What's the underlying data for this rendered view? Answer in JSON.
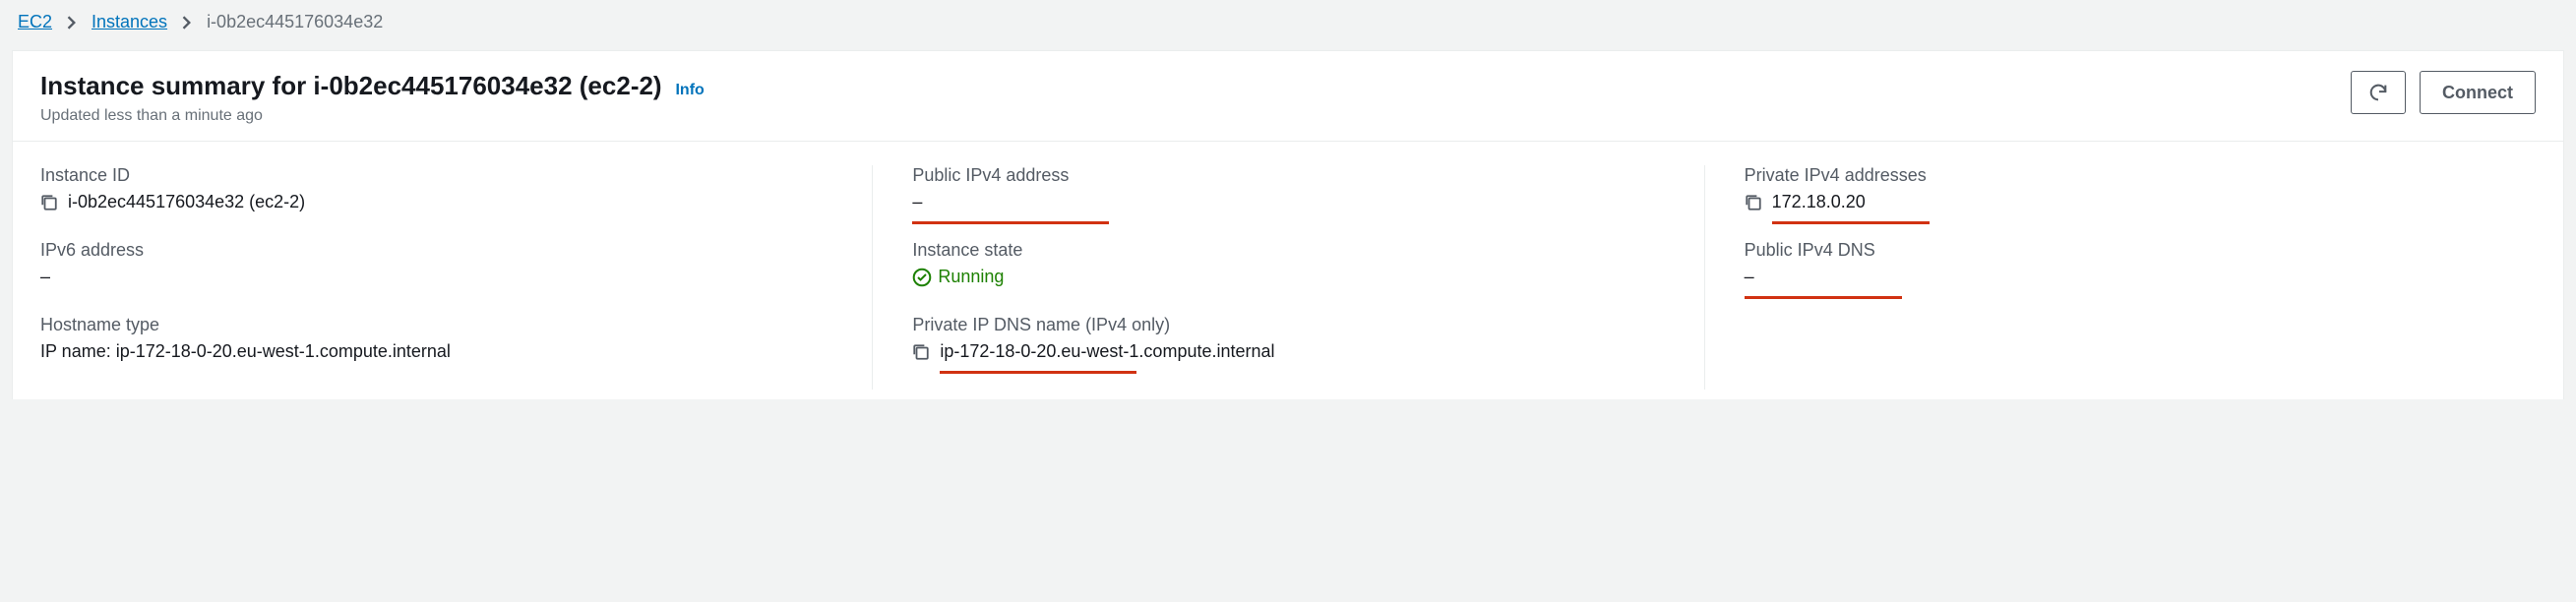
{
  "breadcrumb": {
    "root": "EC2",
    "mid": "Instances",
    "current": "i-0b2ec445176034e32"
  },
  "header": {
    "title": "Instance summary for i-0b2ec445176034e32 (ec2-2)",
    "info": "Info",
    "subtitle": "Updated less than a minute ago",
    "connect": "Connect"
  },
  "fields": {
    "instance_id": {
      "label": "Instance ID",
      "value": "i-0b2ec445176034e32 (ec2-2)"
    },
    "public_ipv4": {
      "label": "Public IPv4 address",
      "value": "–"
    },
    "private_ipv4": {
      "label": "Private IPv4 addresses",
      "value": "172.18.0.20"
    },
    "ipv6": {
      "label": "IPv6 address",
      "value": "–"
    },
    "instance_state": {
      "label": "Instance state",
      "value": "Running"
    },
    "public_dns": {
      "label": "Public IPv4 DNS",
      "value": "–"
    },
    "hostname_type": {
      "label": "Hostname type",
      "value": "IP name: ip-172-18-0-20.eu-west-1.compute.internal"
    },
    "private_dns": {
      "label": "Private IP DNS name (IPv4 only)",
      "value": "ip-172-18-0-20.eu-west-1.compute.internal"
    }
  }
}
